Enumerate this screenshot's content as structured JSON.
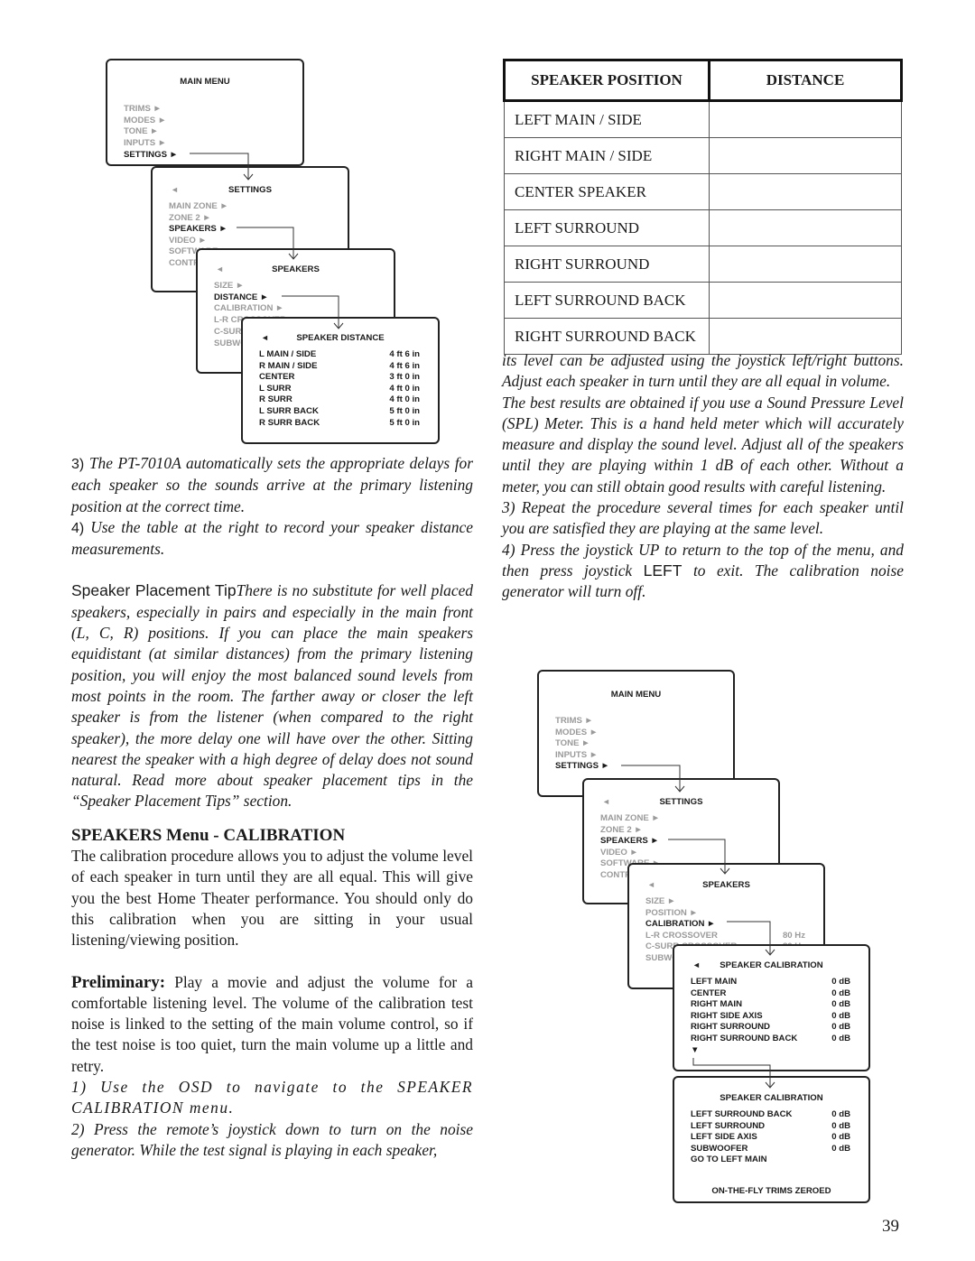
{
  "menus": [
    {
      "title": "MAIN MENU",
      "back": false,
      "items": [
        {
          "l": "TRIMS ►"
        },
        {
          "l": "MODES ►"
        },
        {
          "l": "TONE ►"
        },
        {
          "l": "INPUTS ►"
        },
        {
          "l": "SETTINGS ►",
          "on": true
        }
      ]
    },
    {
      "title": "SETTINGS",
      "back": true,
      "items": [
        {
          "l": "MAIN ZONE ►"
        },
        {
          "l": "ZONE 2 ►"
        },
        {
          "l": "SPEAKERS ►",
          "on": true
        },
        {
          "l": "VIDEO ►"
        },
        {
          "l": "SOFTWARE ►"
        },
        {
          "l": "CONTROL"
        }
      ]
    },
    {
      "title": "SPEAKERS",
      "back": true,
      "items": [
        {
          "l": "SIZE ►"
        },
        {
          "l": "DISTANCE ►",
          "on": true
        },
        {
          "l": "CALIBRATION ►"
        },
        {
          "l": "L-R CROSSOVER"
        },
        {
          "l": "C-SURR CROSSOVER"
        },
        {
          "l": "SUBWOOFER"
        }
      ]
    },
    {
      "title": "SPEAKER DISTANCE",
      "back": true,
      "items": [
        {
          "l": "L MAIN / SIDE",
          "v": "4 ft 6 in",
          "on": true
        },
        {
          "l": "R MAIN / SIDE",
          "v": "4 ft 6 in",
          "on": true
        },
        {
          "l": "CENTER",
          "v": "3 ft 0 in",
          "on": true
        },
        {
          "l": "L SURR",
          "v": "4 ft 0 in",
          "on": true
        },
        {
          "l": "R SURR",
          "v": "4 ft 0 in",
          "on": true
        },
        {
          "l": "L SURR BACK",
          "v": "5 ft 0 in",
          "on": true
        },
        {
          "l": "R SURR BACK",
          "v": "5 ft 0 in",
          "on": true
        }
      ]
    },
    {
      "title": "MAIN MENU",
      "back": false,
      "items": [
        {
          "l": "TRIMS ►"
        },
        {
          "l": "MODES ►"
        },
        {
          "l": "TONE ►"
        },
        {
          "l": "INPUTS ►"
        },
        {
          "l": "SETTINGS ►",
          "on": true
        }
      ]
    },
    {
      "title": "SETTINGS",
      "back": true,
      "items": [
        {
          "l": "MAIN ZONE ►"
        },
        {
          "l": "ZONE 2 ►"
        },
        {
          "l": "SPEAKERS ►",
          "on": true
        },
        {
          "l": "VIDEO ►"
        },
        {
          "l": "SOFTWARE ►"
        },
        {
          "l": "CONTROL"
        }
      ]
    },
    {
      "title": "SPEAKERS",
      "back": true,
      "items": [
        {
          "l": "SIZE ►"
        },
        {
          "l": "POSITION ►"
        },
        {
          "l": "CALIBRATION ►",
          "on": true
        },
        {
          "l": "L-R CROSSOVER",
          "v": "80 Hz"
        },
        {
          "l": "C-SURR CROSSOVER",
          "v": "80 Hz"
        },
        {
          "l": "SUBWOOFER"
        }
      ]
    },
    {
      "title": "SPEAKER CALIBRATION",
      "back": true,
      "items": [
        {
          "l": "LEFT MAIN",
          "v": "0 dB",
          "on": true
        },
        {
          "l": "CENTER",
          "v": "0 dB",
          "on": true
        },
        {
          "l": "RIGHT MAIN",
          "v": "0 dB",
          "on": true
        },
        {
          "l": "RIGHT SIDE AXIS",
          "v": "0 dB",
          "on": true
        },
        {
          "l": "RIGHT SURROUND",
          "v": "0 dB",
          "on": true
        },
        {
          "l": "RIGHT SURROUND BACK",
          "v": "0 dB",
          "on": true
        },
        {
          "l": "▼",
          "on": true
        }
      ]
    },
    {
      "title": "SPEAKER CALIBRATION",
      "back": false,
      "items": [
        {
          "l": "LEFT SURROUND BACK",
          "v": "0 dB",
          "on": true
        },
        {
          "l": "LEFT SURROUND",
          "v": "0 dB",
          "on": true
        },
        {
          "l": "LEFT SIDE AXIS",
          "v": "0 dB",
          "on": true
        },
        {
          "l": "SUBWOOFER",
          "v": "0 dB",
          "on": true
        },
        {
          "l": "GO TO LEFT MAIN",
          "on": true
        }
      ],
      "footer": "ON-THE-FLY TRIMS ZEROED"
    }
  ],
  "table": {
    "headers": [
      "SPEAKER POSITION",
      "DISTANCE"
    ],
    "rows": [
      "LEFT MAIN / SIDE",
      "RIGHT MAIN / SIDE",
      "CENTER SPEAKER",
      "LEFT SURROUND",
      "RIGHT SURROUND",
      "LEFT SURROUND BACK",
      "RIGHT SURROUND BACK"
    ]
  },
  "left": {
    "p3_num": "3)",
    "p3": "The PT-7010A automatically sets the appropriate delays for each speaker so the sounds arrive at the primary listening position at the correct time.",
    "p4_num": "4)",
    "p4": "Use the table at the right to record your speaker distance measurements.",
    "tip_label": "Speaker Placement Tip",
    "tip": "There is no substitute for well placed speakers, especially in pairs and especially in the main front (L, C, R) positions. If you can place the main speakers equidistant (at similar distances) from the primary listening position, you will enjoy the most balanced sound levels from most points in the room. The farther away or closer the left speaker is from the listener (when compared to the right speaker), the more delay one will have over the other. Sitting nearest the speaker with a high degree of delay does not sound natural. Read more about speaker placement tips in the “Speaker Placement Tips” section.",
    "heading": "SPEAKERS Menu - CALIBRATION",
    "cal": "The calibration procedure allows you to adjust the volume level of each speaker in turn until they are all equal. This will give you the best Home Theater performance. You should only do this calibration when you are sitting in your usual listening/viewing position.",
    "prelim_label": "Preliminary:",
    "prelim": " Play a movie and adjust the volume for a comfortable listening level. The volume of the calibration test noise is linked to the setting of the main volume control, so if the test noise is too quiet, turn the main volume up a little and retry.",
    "s1": "1) Use the OSD to navigate to the SPEAKER CALIBRATION menu.",
    "s2": "2) Press the remote’s joystick down to turn on the noise generator. While the test signal is playing in each speaker,"
  },
  "right": {
    "r1": "its level can be adjusted using the joystick left/right buttons. Adjust each speaker in turn until they are all equal in volume.",
    "r2": "The best results are obtained if you use a Sound Pressure Level (SPL) Meter. This is a hand held meter which will accurately measure and display the sound level. Adjust all of the speakers until they are playing within 1 dB of each other. Without a meter, you can still obtain good results with careful listening.",
    "r3": "3) Repeat the procedure several times for each speaker until you are satisfied they are playing at the same level.",
    "r4a": "4) Press the joystick UP to return to the top of the menu, and then press joystick ",
    "r4key": "LEFT",
    "r4b": " to exit. The calibration noise generator will turn off."
  },
  "page_number": "39"
}
